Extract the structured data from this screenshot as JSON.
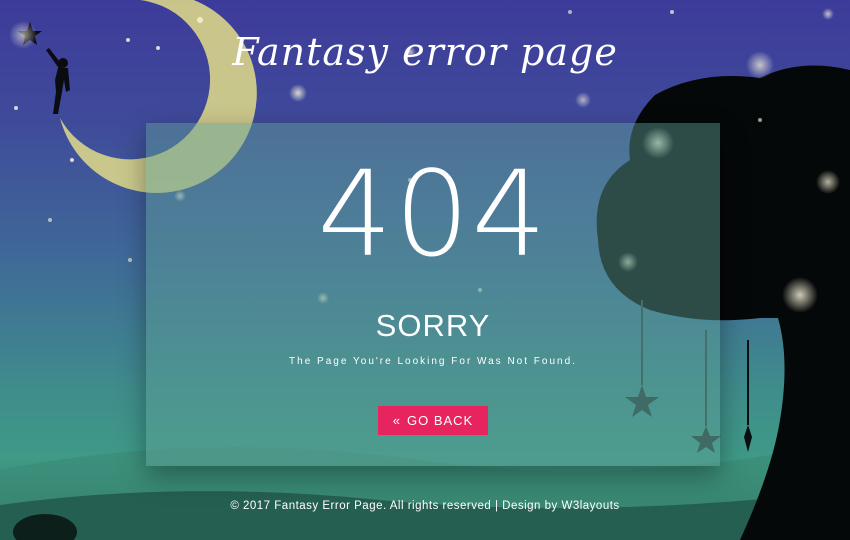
{
  "header": {
    "title": "Fantasy error page"
  },
  "error": {
    "code": "404",
    "heading": "SORRY",
    "message": "The Page You're Looking For Was Not Found.",
    "button_icon": "«",
    "button_label": "GO BACK"
  },
  "footer": {
    "copyright": "© 2017 Fantasy Error Page. All rights reserved | Design by W3layouts"
  },
  "icons": [
    "star-icon",
    "double-chevron-left-icon"
  ],
  "colors": {
    "accent": "#e8245f",
    "sky_top": "#3d3b9a",
    "ground": "#2f6e60"
  }
}
